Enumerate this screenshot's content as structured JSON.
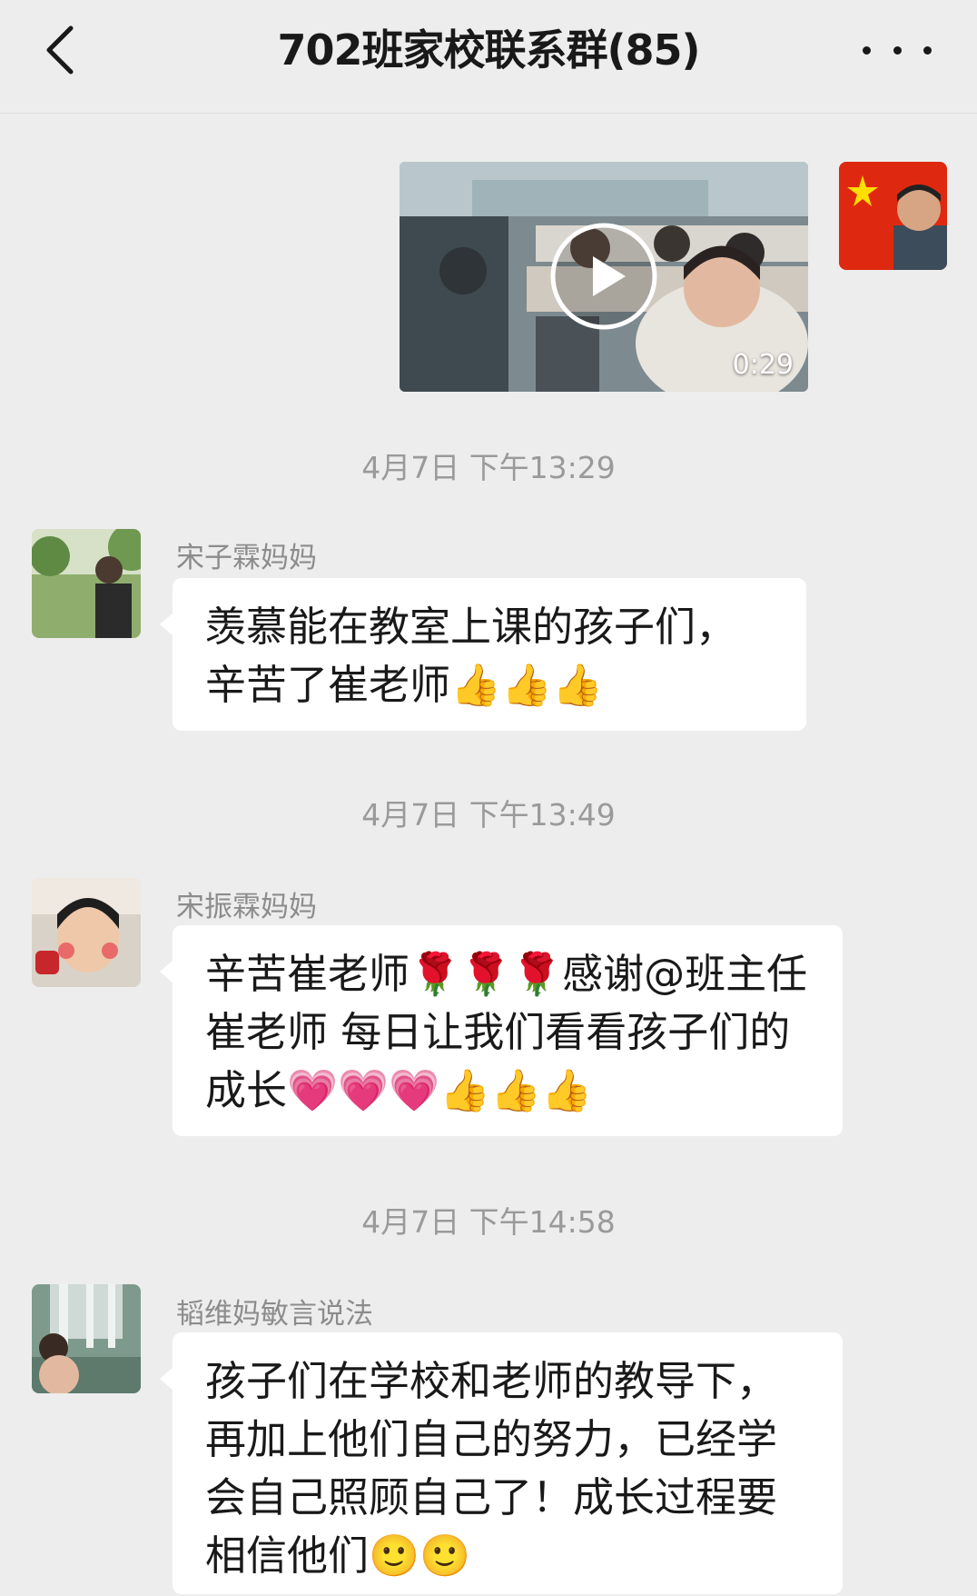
{
  "header": {
    "title": "702班家校联系群(85)",
    "back_icon": "chevron-left-icon",
    "more_icon": "more-dots-icon"
  },
  "video_message": {
    "duration": "0:29",
    "play_icon": "play-icon"
  },
  "messages": [
    {
      "timestamp": "4月7日 下午13:29",
      "sender": "宋子霖妈妈",
      "text": "羡慕能在教室上课的孩子们，辛苦了崔老师👍👍👍"
    },
    {
      "timestamp": "4月7日 下午13:49",
      "sender": "宋振霖妈妈",
      "text": "辛苦崔老师🌹🌹🌹感谢@班主任 崔老师  每日让我们看看孩子们的成长💗💗💗👍👍👍"
    },
    {
      "timestamp": "4月7日 下午14:58",
      "sender": "韬维妈敏言说法",
      "text": "孩子们在学校和老师的教导下，再加上他们自己的努力，已经学会自己照顾自己了！成长过程要相信他们🙂🙂"
    }
  ],
  "colors": {
    "background": "#ededed",
    "bubble": "#ffffff",
    "timestamp": "#9a9a9a",
    "sender": "#8c8c8c",
    "text": "#191919"
  }
}
